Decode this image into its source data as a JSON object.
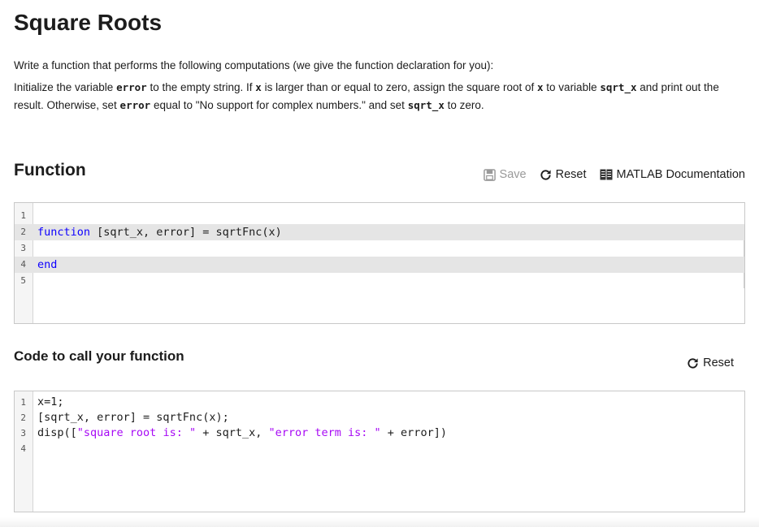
{
  "page": {
    "title": "Square Roots",
    "description_line1": "Write a function that performs the following computations (we give the function declaration for you):",
    "description_p2": [
      {
        "t": "Initialize the variable "
      },
      {
        "c": "error"
      },
      {
        "t": " to the empty string. If "
      },
      {
        "c": "x"
      },
      {
        "t": " is larger than or equal to zero, assign the square root of "
      },
      {
        "c": "x"
      },
      {
        "t": " to variable "
      },
      {
        "c": "sqrt_x"
      },
      {
        "t": "  and print out the result. Otherwise, set "
      },
      {
        "c": "error"
      },
      {
        "t": " equal to \"No support for complex numbers.\" and set "
      },
      {
        "c": "sqrt_x"
      },
      {
        "t": " to zero."
      }
    ]
  },
  "function_section": {
    "title": "Function",
    "save_label": "Save",
    "reset_label": "Reset",
    "docs_label": "MATLAB Documentation",
    "icons": {
      "save": "save-icon",
      "reset": "reset-icon",
      "docs": "book-icon"
    },
    "editor": {
      "lines": [
        {
          "n": "1",
          "tokens": [],
          "highlight": false
        },
        {
          "n": "2",
          "tokens": [
            {
              "k": "kw",
              "v": "function"
            },
            {
              "k": "",
              "v": " [sqrt_x, error] = sqrtFnc(x)"
            }
          ],
          "highlight": true
        },
        {
          "n": "3",
          "tokens": [],
          "highlight": false
        },
        {
          "n": "4",
          "tokens": [
            {
              "k": "kw",
              "v": "end"
            }
          ],
          "highlight": true
        },
        {
          "n": "5",
          "tokens": [],
          "highlight": false
        }
      ]
    }
  },
  "call_section": {
    "title": "Code to call your function",
    "reset_label": "Reset",
    "editor": {
      "lines": [
        {
          "n": "1",
          "tokens": [
            {
              "k": "",
              "v": "x=1;"
            }
          ]
        },
        {
          "n": "2",
          "tokens": [
            {
              "k": "",
              "v": "[sqrt_x, error] = sqrtFnc(x);"
            }
          ]
        },
        {
          "n": "3",
          "tokens": [
            {
              "k": "",
              "v": "disp(["
            },
            {
              "k": "str",
              "v": "\"square root is: \""
            },
            {
              "k": "",
              "v": " + sqrt_x, "
            },
            {
              "k": "str",
              "v": "\"error term is: \""
            },
            {
              "k": "",
              "v": " + error])"
            }
          ]
        },
        {
          "n": "4",
          "tokens": []
        }
      ]
    }
  },
  "colors": {
    "keyword": "#0e00ff",
    "string": "#a709f5",
    "highlight": "#e5e5e5"
  }
}
